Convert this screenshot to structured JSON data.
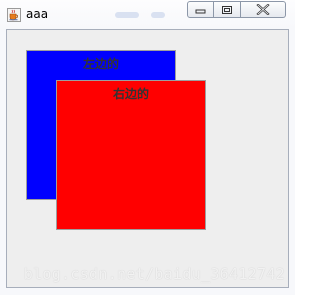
{
  "window": {
    "title": "aaa",
    "app_icon": "java-cup-icon",
    "controls": {
      "minimize_icon": "minimize-icon",
      "maximize_icon": "maximize-icon",
      "close_icon": "close-icon"
    }
  },
  "panels": {
    "left": {
      "label": "左边的",
      "color": "#0000ff"
    },
    "right": {
      "label": "右边的",
      "color": "#ff0000"
    }
  },
  "watermark": "blog.csdn.net/baidu_36412742"
}
